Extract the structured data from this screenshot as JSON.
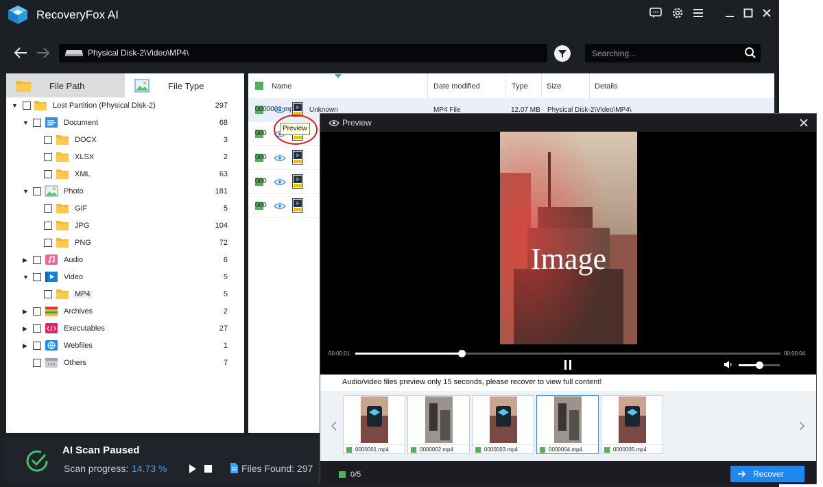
{
  "app": {
    "title": "RecoveryFox AI"
  },
  "titlebar": {
    "icons": [
      "feedback-icon",
      "settings-icon",
      "menu-icon",
      "minimize-icon",
      "maximize-icon",
      "close-icon"
    ]
  },
  "nav": {
    "path": "Physical Disk-2\\Video\\MP4\\",
    "search_placeholder": "Searching..."
  },
  "tabs": [
    {
      "label": "File Path",
      "icon": "folder-icon"
    },
    {
      "label": "File Type",
      "icon": "image-icon"
    }
  ],
  "tree": [
    {
      "label": "Lost Partition (Physical Disk-2)",
      "count": "297",
      "level": 0,
      "expand": "open",
      "icon": "folder"
    },
    {
      "label": "Document",
      "count": "68",
      "level": 1,
      "expand": "open",
      "icon": "document"
    },
    {
      "label": "DOCX",
      "count": "3",
      "level": 2,
      "expand": "",
      "icon": "folder"
    },
    {
      "label": "XLSX",
      "count": "2",
      "level": 2,
      "expand": "",
      "icon": "folder"
    },
    {
      "label": "XML",
      "count": "63",
      "level": 2,
      "expand": "",
      "icon": "folder"
    },
    {
      "label": "Photo",
      "count": "181",
      "level": 1,
      "expand": "open",
      "icon": "photo"
    },
    {
      "label": "GIF",
      "count": "5",
      "level": 2,
      "expand": "",
      "icon": "folder"
    },
    {
      "label": "JPG",
      "count": "104",
      "level": 2,
      "expand": "",
      "icon": "folder"
    },
    {
      "label": "PNG",
      "count": "72",
      "level": 2,
      "expand": "",
      "icon": "folder"
    },
    {
      "label": "Audio",
      "count": "6",
      "level": 1,
      "expand": "closed",
      "icon": "audio"
    },
    {
      "label": "Video",
      "count": "5",
      "level": 1,
      "expand": "open",
      "icon": "video"
    },
    {
      "label": "MP4",
      "count": "5",
      "level": 2,
      "expand": "",
      "icon": "folder",
      "selected": true
    },
    {
      "label": "Archives",
      "count": "2",
      "level": 1,
      "expand": "closed",
      "icon": "archive"
    },
    {
      "label": "Executables",
      "count": "27",
      "level": 1,
      "expand": "closed",
      "icon": "exe"
    },
    {
      "label": "Webfiles",
      "count": "1",
      "level": 1,
      "expand": "closed",
      "icon": "web"
    },
    {
      "label": "Others",
      "count": "7",
      "level": 1,
      "expand": "",
      "icon": "others"
    }
  ],
  "file_table": {
    "headers": [
      "Name",
      "Date modified",
      "Type",
      "Size",
      "Details"
    ],
    "rows": [
      {
        "name": "0000001.mp4",
        "date": "Unknown",
        "type": "MP4 File",
        "size": "12.07 MB",
        "details": "Physical Disk-2\\Video\\MP4\\"
      },
      {
        "name": "000",
        "date": "",
        "type": "",
        "size": "",
        "details": ""
      },
      {
        "name": "000",
        "date": "",
        "type": "",
        "size": "",
        "details": ""
      },
      {
        "name": "000",
        "date": "",
        "type": "",
        "size": "",
        "details": ""
      },
      {
        "name": "000",
        "date": "",
        "type": "",
        "size": "",
        "details": ""
      }
    ],
    "tooltip": "Preview"
  },
  "status": {
    "title": "AI Scan Paused",
    "progress_label": "Scan progress:",
    "progress_value": "14.73 %",
    "files_found": "Files Found: 297"
  },
  "preview": {
    "title": "Preview",
    "image_text": "Image",
    "time_current": "00:00:01",
    "time_total": "00:00:04",
    "progress": 0.25,
    "volume": 0.5,
    "notice": "Audio/video files preview only 15 seconds, please recover to view full content!",
    "thumbnails": [
      "0000001.mp4",
      "0000002.mp4",
      "0000003.mp4",
      "0000004.mp4",
      "0000005.mp4"
    ],
    "selected_count": "0/5",
    "recover_label": "Recover"
  },
  "colors": {
    "accent": "#1e88f0",
    "green": "#54b05c",
    "dark": "#1c1f24"
  }
}
